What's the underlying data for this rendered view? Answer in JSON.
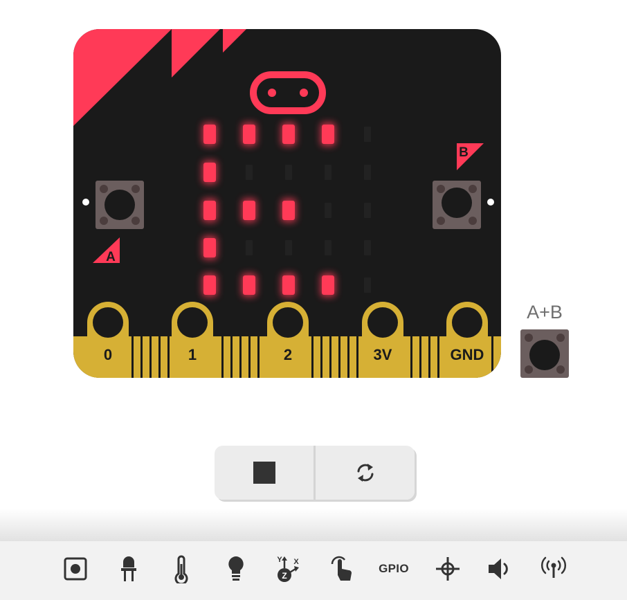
{
  "board": {
    "pins": [
      "0",
      "1",
      "2",
      "3V",
      "GND"
    ],
    "button_a_label": "A",
    "button_b_label": "B",
    "colors": {
      "body": "#1a1a1a",
      "accent": "#ff3a57",
      "gold": "#d6b035",
      "led_on": "#ff3a57",
      "led_off": "#222222",
      "button_body": "#6b5e5e"
    },
    "led_matrix": [
      [
        1,
        1,
        1,
        1,
        0
      ],
      [
        1,
        0,
        0,
        0,
        0
      ],
      [
        1,
        1,
        1,
        0,
        0
      ],
      [
        1,
        0,
        0,
        0,
        0
      ],
      [
        1,
        1,
        1,
        1,
        0
      ]
    ]
  },
  "ab_button": {
    "label": "A+B"
  },
  "controls": {
    "stop": {
      "icon": "stop-icon"
    },
    "restart": {
      "icon": "restart-icon"
    }
  },
  "toolbar": {
    "items": [
      {
        "icon": "button-icon"
      },
      {
        "icon": "led-icon"
      },
      {
        "icon": "thermometer-icon"
      },
      {
        "icon": "lightbulb-icon"
      },
      {
        "icon": "accelerometer-icon"
      },
      {
        "icon": "touch-icon"
      },
      {
        "icon": "gpio-icon",
        "label": "GPIO"
      },
      {
        "icon": "compass-icon"
      },
      {
        "icon": "speaker-icon"
      },
      {
        "icon": "radio-icon"
      }
    ]
  }
}
